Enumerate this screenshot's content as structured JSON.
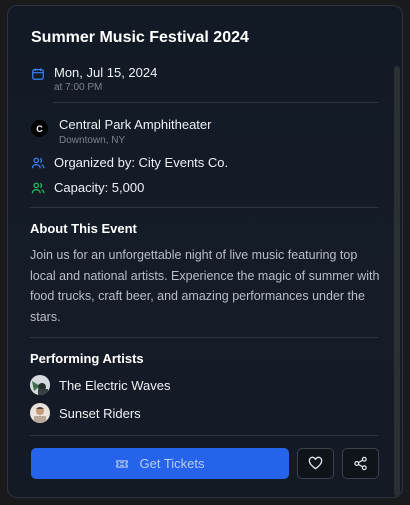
{
  "event": {
    "title": "Summer Music Festival 2024",
    "date": "Mon, Jul 15, 2024",
    "time": "at 7:00 PM",
    "venue": "Central Park Amphitheater",
    "venue_badge": "C",
    "location": "Downtown, NY",
    "organizer": "Organized by: City Events Co.",
    "capacity": "Capacity: 5,000"
  },
  "about": {
    "heading": "About This Event",
    "description": "Join us for an unforgettable night of live music featuring top local and national artists. Experience the magic of summer with food trucks, craft beer, and amazing performances under the stars."
  },
  "artists": {
    "heading": "Performing Artists",
    "items": [
      {
        "name": "The Electric Waves",
        "icon": "avatar-image"
      },
      {
        "name": "Sunset Riders",
        "icon": "avatar-image"
      }
    ]
  },
  "actions": {
    "primary_label": "Get Tickets",
    "primary_icon": "ticket-icon",
    "favorite_icon": "heart-icon",
    "share_icon": "share-icon"
  },
  "colors": {
    "accent": "#2563eb",
    "calendar_icon": "#3b82f6",
    "organizer_icon": "#3b82f6",
    "capacity_icon": "#22c55e"
  }
}
